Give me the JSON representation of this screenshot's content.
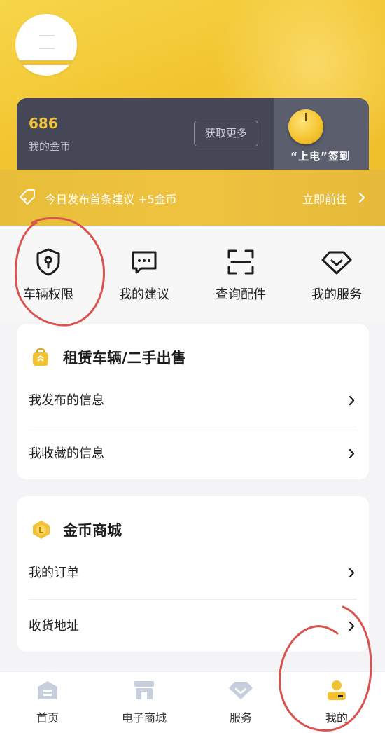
{
  "coins": {
    "value": "686",
    "label": "我的金币",
    "more_button": "获取更多",
    "signin_label": "“上电”签到"
  },
  "banner": {
    "text": "今日发布首条建议 +5金币",
    "link": "立即前往"
  },
  "quick_actions": [
    {
      "label": "车辆权限",
      "icon": "shield-key-icon"
    },
    {
      "label": "我的建议",
      "icon": "message-dots-icon"
    },
    {
      "label": "查询配件",
      "icon": "scan-icon"
    },
    {
      "label": "我的服务",
      "icon": "diamond-icon"
    }
  ],
  "rental_section": {
    "title": "租赁车辆/二手出售",
    "icon": "bag-icon",
    "items": [
      {
        "label": "我发布的信息"
      },
      {
        "label": "我收藏的信息"
      }
    ]
  },
  "coin_mall_section": {
    "title": "金币商城",
    "icon": "coin-icon",
    "items": [
      {
        "label": "我的订单"
      },
      {
        "label": "收货地址"
      }
    ]
  },
  "tabbar": [
    {
      "label": "首页",
      "icon": "home-icon",
      "active": false
    },
    {
      "label": "电子商城",
      "icon": "store-icon",
      "active": false
    },
    {
      "label": "服务",
      "icon": "diamond-tab-icon",
      "active": false
    },
    {
      "label": "我的",
      "icon": "profile-icon",
      "active": true
    }
  ],
  "colors": {
    "accent": "#f4c436",
    "annotation": "#d9534f",
    "tab_inactive": "#c7cfdc",
    "dark_card": "#454757"
  }
}
